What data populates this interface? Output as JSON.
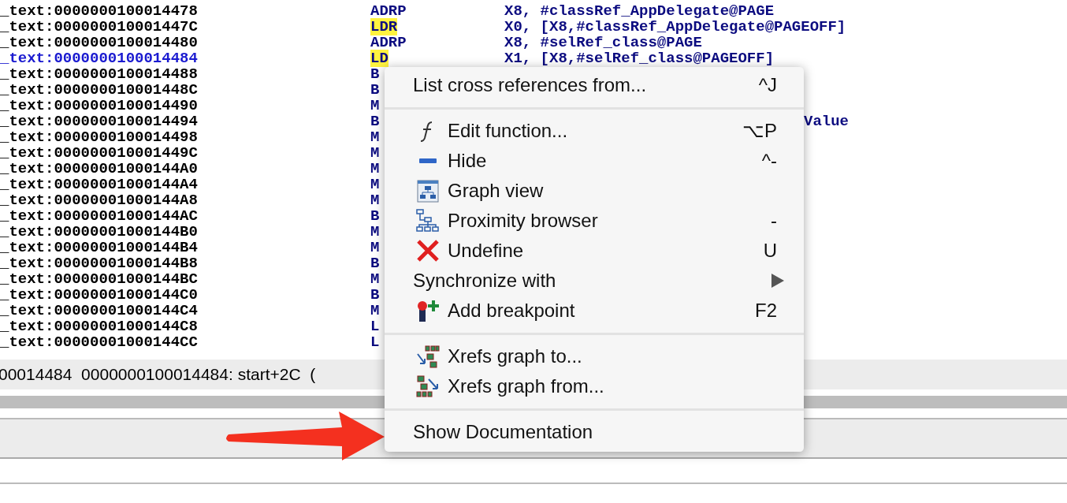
{
  "listing": [
    {
      "address": "_text:0000000100014478",
      "mnemonic": "ADRP",
      "highlighted": false,
      "selected": false,
      "operand": "X8, #classRef_AppDelegate@PAGE"
    },
    {
      "address": "_text:000000010001447C",
      "mnemonic": "LDR",
      "highlighted": true,
      "selected": false,
      "operand": "X0, [X8,#classRef_AppDelegate@PAGEOFF]"
    },
    {
      "address": "_text:0000000100014480",
      "mnemonic": "ADRP",
      "highlighted": false,
      "selected": false,
      "operand": "X8, #selRef_class@PAGE"
    },
    {
      "address": "_text:0000000100014484",
      "mnemonic": "LD",
      "highlighted": true,
      "selected": true,
      "operand": "X1, [X8,#selRef_class@PAGEOFF]"
    },
    {
      "address": "_text:0000000100014488",
      "mnemonic": "B",
      "highlighted": false,
      "selected": false
    },
    {
      "address": "_text:000000010001448C",
      "mnemonic": "B",
      "highlighted": false,
      "selected": false
    },
    {
      "address": "_text:0000000100014490",
      "mnemonic": "M",
      "highlighted": false,
      "selected": false
    },
    {
      "address": "_text:0000000100014494",
      "mnemonic": "B",
      "highlighted": false,
      "selected": false,
      "operand_tail": "Value"
    },
    {
      "address": "_text:0000000100014498",
      "mnemonic": "M",
      "highlighted": false,
      "selected": false
    },
    {
      "address": "_text:000000010001449C",
      "mnemonic": "M",
      "highlighted": false,
      "selected": false
    },
    {
      "address": "_text:00000001000144A0",
      "mnemonic": "M",
      "highlighted": false,
      "selected": false
    },
    {
      "address": "_text:00000001000144A4",
      "mnemonic": "M",
      "highlighted": false,
      "selected": false
    },
    {
      "address": "_text:00000001000144A8",
      "mnemonic": "M",
      "highlighted": false,
      "selected": false
    },
    {
      "address": "_text:00000001000144AC",
      "mnemonic": "B",
      "highlighted": false,
      "selected": false
    },
    {
      "address": "_text:00000001000144B0",
      "mnemonic": "M",
      "highlighted": false,
      "selected": false
    },
    {
      "address": "_text:00000001000144B4",
      "mnemonic": "M",
      "highlighted": false,
      "selected": false
    },
    {
      "address": "_text:00000001000144B8",
      "mnemonic": "B",
      "highlighted": false,
      "selected": false
    },
    {
      "address": "_text:00000001000144BC",
      "mnemonic": "M",
      "highlighted": false,
      "selected": false
    },
    {
      "address": "_text:00000001000144C0",
      "mnemonic": "B",
      "highlighted": false,
      "selected": false
    },
    {
      "address": "_text:00000001000144C4",
      "mnemonic": "M",
      "highlighted": false,
      "selected": false
    },
    {
      "address": "_text:00000001000144C8",
      "mnemonic": "L",
      "highlighted": false,
      "selected": false
    },
    {
      "address": "_text:00000001000144CC",
      "mnemonic": "L",
      "highlighted": false,
      "selected": false
    }
  ],
  "status_bar": {
    "text": "00014484  0000000100014484: start+2C  ("
  },
  "context_menu": [
    {
      "kind": "text-item",
      "label": "List cross references from...",
      "shortcut": "^J"
    },
    {
      "kind": "separator"
    },
    {
      "kind": "icon-item",
      "label": "Edit function...",
      "shortcut": "⌥P"
    },
    {
      "kind": "icon-item",
      "label": "Hide",
      "shortcut": "^-"
    },
    {
      "kind": "icon-item",
      "label": "Graph view"
    },
    {
      "kind": "icon-item",
      "label": "Proximity browser",
      "shortcut": "-"
    },
    {
      "kind": "icon-item",
      "label": "Undefine",
      "shortcut": "U"
    },
    {
      "kind": "submenu",
      "label": "Synchronize with"
    },
    {
      "kind": "icon-item",
      "label": "Add breakpoint",
      "shortcut": "F2"
    },
    {
      "kind": "separator"
    },
    {
      "kind": "icon-item",
      "label": "Xrefs graph to..."
    },
    {
      "kind": "icon-item",
      "label": "Xrefs graph from..."
    },
    {
      "kind": "separator"
    },
    {
      "kind": "text-item",
      "label": "Show Documentation"
    }
  ]
}
